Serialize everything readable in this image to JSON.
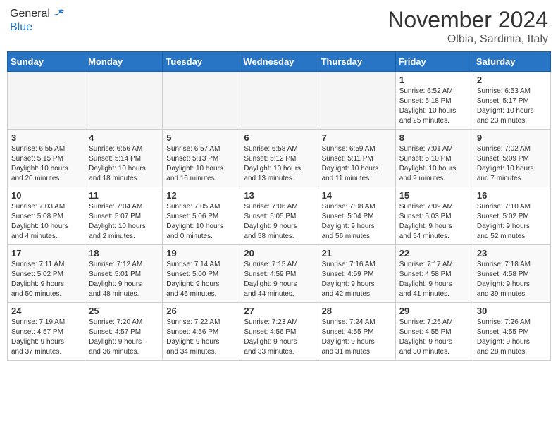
{
  "header": {
    "logo_line1": "General",
    "logo_line2": "Blue",
    "month_title": "November 2024",
    "location": "Olbia, Sardinia, Italy"
  },
  "weekdays": [
    "Sunday",
    "Monday",
    "Tuesday",
    "Wednesday",
    "Thursday",
    "Friday",
    "Saturday"
  ],
  "weeks": [
    [
      {
        "day": "",
        "info": ""
      },
      {
        "day": "",
        "info": ""
      },
      {
        "day": "",
        "info": ""
      },
      {
        "day": "",
        "info": ""
      },
      {
        "day": "",
        "info": ""
      },
      {
        "day": "1",
        "info": "Sunrise: 6:52 AM\nSunset: 5:18 PM\nDaylight: 10 hours\nand 25 minutes."
      },
      {
        "day": "2",
        "info": "Sunrise: 6:53 AM\nSunset: 5:17 PM\nDaylight: 10 hours\nand 23 minutes."
      }
    ],
    [
      {
        "day": "3",
        "info": "Sunrise: 6:55 AM\nSunset: 5:15 PM\nDaylight: 10 hours\nand 20 minutes."
      },
      {
        "day": "4",
        "info": "Sunrise: 6:56 AM\nSunset: 5:14 PM\nDaylight: 10 hours\nand 18 minutes."
      },
      {
        "day": "5",
        "info": "Sunrise: 6:57 AM\nSunset: 5:13 PM\nDaylight: 10 hours\nand 16 minutes."
      },
      {
        "day": "6",
        "info": "Sunrise: 6:58 AM\nSunset: 5:12 PM\nDaylight: 10 hours\nand 13 minutes."
      },
      {
        "day": "7",
        "info": "Sunrise: 6:59 AM\nSunset: 5:11 PM\nDaylight: 10 hours\nand 11 minutes."
      },
      {
        "day": "8",
        "info": "Sunrise: 7:01 AM\nSunset: 5:10 PM\nDaylight: 10 hours\nand 9 minutes."
      },
      {
        "day": "9",
        "info": "Sunrise: 7:02 AM\nSunset: 5:09 PM\nDaylight: 10 hours\nand 7 minutes."
      }
    ],
    [
      {
        "day": "10",
        "info": "Sunrise: 7:03 AM\nSunset: 5:08 PM\nDaylight: 10 hours\nand 4 minutes."
      },
      {
        "day": "11",
        "info": "Sunrise: 7:04 AM\nSunset: 5:07 PM\nDaylight: 10 hours\nand 2 minutes."
      },
      {
        "day": "12",
        "info": "Sunrise: 7:05 AM\nSunset: 5:06 PM\nDaylight: 10 hours\nand 0 minutes."
      },
      {
        "day": "13",
        "info": "Sunrise: 7:06 AM\nSunset: 5:05 PM\nDaylight: 9 hours\nand 58 minutes."
      },
      {
        "day": "14",
        "info": "Sunrise: 7:08 AM\nSunset: 5:04 PM\nDaylight: 9 hours\nand 56 minutes."
      },
      {
        "day": "15",
        "info": "Sunrise: 7:09 AM\nSunset: 5:03 PM\nDaylight: 9 hours\nand 54 minutes."
      },
      {
        "day": "16",
        "info": "Sunrise: 7:10 AM\nSunset: 5:02 PM\nDaylight: 9 hours\nand 52 minutes."
      }
    ],
    [
      {
        "day": "17",
        "info": "Sunrise: 7:11 AM\nSunset: 5:02 PM\nDaylight: 9 hours\nand 50 minutes."
      },
      {
        "day": "18",
        "info": "Sunrise: 7:12 AM\nSunset: 5:01 PM\nDaylight: 9 hours\nand 48 minutes."
      },
      {
        "day": "19",
        "info": "Sunrise: 7:14 AM\nSunset: 5:00 PM\nDaylight: 9 hours\nand 46 minutes."
      },
      {
        "day": "20",
        "info": "Sunrise: 7:15 AM\nSunset: 4:59 PM\nDaylight: 9 hours\nand 44 minutes."
      },
      {
        "day": "21",
        "info": "Sunrise: 7:16 AM\nSunset: 4:59 PM\nDaylight: 9 hours\nand 42 minutes."
      },
      {
        "day": "22",
        "info": "Sunrise: 7:17 AM\nSunset: 4:58 PM\nDaylight: 9 hours\nand 41 minutes."
      },
      {
        "day": "23",
        "info": "Sunrise: 7:18 AM\nSunset: 4:58 PM\nDaylight: 9 hours\nand 39 minutes."
      }
    ],
    [
      {
        "day": "24",
        "info": "Sunrise: 7:19 AM\nSunset: 4:57 PM\nDaylight: 9 hours\nand 37 minutes."
      },
      {
        "day": "25",
        "info": "Sunrise: 7:20 AM\nSunset: 4:57 PM\nDaylight: 9 hours\nand 36 minutes."
      },
      {
        "day": "26",
        "info": "Sunrise: 7:22 AM\nSunset: 4:56 PM\nDaylight: 9 hours\nand 34 minutes."
      },
      {
        "day": "27",
        "info": "Sunrise: 7:23 AM\nSunset: 4:56 PM\nDaylight: 9 hours\nand 33 minutes."
      },
      {
        "day": "28",
        "info": "Sunrise: 7:24 AM\nSunset: 4:55 PM\nDaylight: 9 hours\nand 31 minutes."
      },
      {
        "day": "29",
        "info": "Sunrise: 7:25 AM\nSunset: 4:55 PM\nDaylight: 9 hours\nand 30 minutes."
      },
      {
        "day": "30",
        "info": "Sunrise: 7:26 AM\nSunset: 4:55 PM\nDaylight: 9 hours\nand 28 minutes."
      }
    ]
  ]
}
